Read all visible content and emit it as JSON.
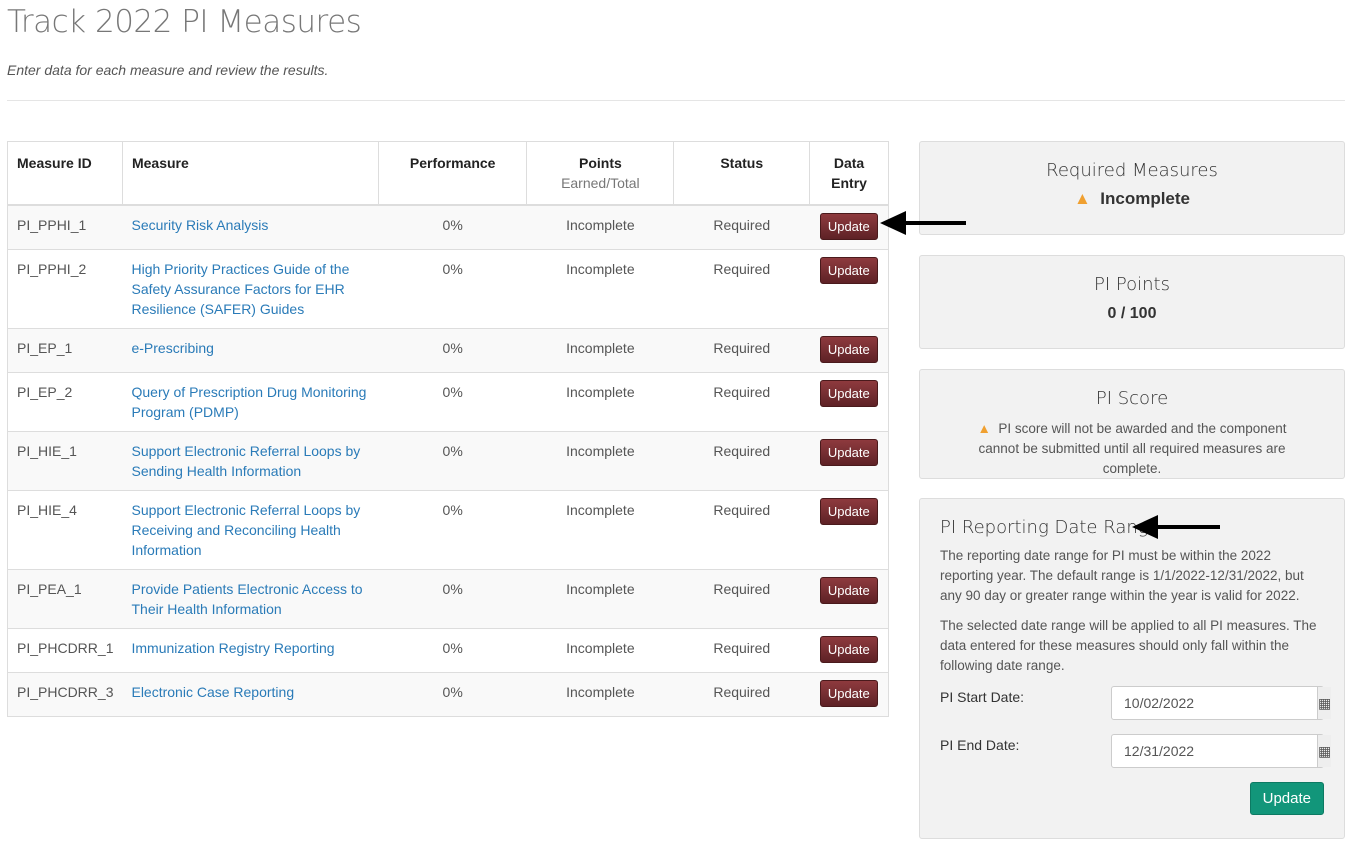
{
  "title": "Track 2022 PI Measures",
  "subtitle": "Enter data for each measure and review the results.",
  "table": {
    "headers": {
      "id": "Measure ID",
      "measure": "Measure",
      "performance": "Performance",
      "points": "Points",
      "points_sub": "Earned/Total",
      "status": "Status",
      "entry": "Data Entry"
    },
    "rows": [
      {
        "id": "PI_PPHI_1",
        "measure": "Security Risk Analysis",
        "performance": "0%",
        "points": "Incomplete",
        "status": "Required",
        "button": "Update"
      },
      {
        "id": "PI_PPHI_2",
        "measure": "High Priority Practices Guide of the Safety Assurance Factors for EHR Resilience (SAFER) Guides",
        "performance": "0%",
        "points": "Incomplete",
        "status": "Required",
        "button": "Update"
      },
      {
        "id": "PI_EP_1",
        "measure": "e-Prescribing",
        "performance": "0%",
        "points": "Incomplete",
        "status": "Required",
        "button": "Update"
      },
      {
        "id": "PI_EP_2",
        "measure": "Query of Prescription Drug Monitoring Program (PDMP)",
        "performance": "0%",
        "points": "Incomplete",
        "status": "Required",
        "button": "Update"
      },
      {
        "id": "PI_HIE_1",
        "measure": "Support Electronic Referral Loops by Sending Health Information",
        "performance": "0%",
        "points": "Incomplete",
        "status": "Required",
        "button": "Update"
      },
      {
        "id": "PI_HIE_4",
        "measure": "Support Electronic Referral Loops by Receiving and Reconciling Health Information",
        "performance": "0%",
        "points": "Incomplete",
        "status": "Required",
        "button": "Update"
      },
      {
        "id": "PI_PEA_1",
        "measure": "Provide Patients Electronic Access to Their Health Information",
        "performance": "0%",
        "points": "Incomplete",
        "status": "Required",
        "button": "Update"
      },
      {
        "id": "PI_PHCDRR_1",
        "measure": "Immunization Registry Reporting",
        "performance": "0%",
        "points": "Incomplete",
        "status": "Required",
        "button": "Update"
      },
      {
        "id": "PI_PHCDRR_3",
        "measure": "Electronic Case Reporting",
        "performance": "0%",
        "points": "Incomplete",
        "status": "Required",
        "button": "Update"
      }
    ]
  },
  "required": {
    "title": "Required Measures",
    "status": "Incomplete",
    "icon": "warning-icon"
  },
  "points": {
    "title": "PI Points",
    "value": "0 / 100"
  },
  "score": {
    "title": "PI Score",
    "message": "PI score will not be awarded and the component cannot be submitted until all required measures are complete."
  },
  "daterange": {
    "title": "PI Reporting Date Range",
    "p1": "The reporting date range for PI must be within the 2022 reporting year. The default range is 1/1/2022-12/31/2022, but any 90 day or greater range within the year is valid for 2022.",
    "p2": "The selected date range will be applied to all PI measures. The data entered for these measures should only fall within the following date range.",
    "start_label": "PI Start Date:",
    "start_value": "10/02/2022",
    "end_label": "PI End Date:",
    "end_value": "12/31/2022",
    "button": "Update"
  },
  "colors": {
    "update_button": "#7a2e32",
    "green_button": "#12967a",
    "link": "#2a7bb8",
    "warning": "#f0a030"
  }
}
